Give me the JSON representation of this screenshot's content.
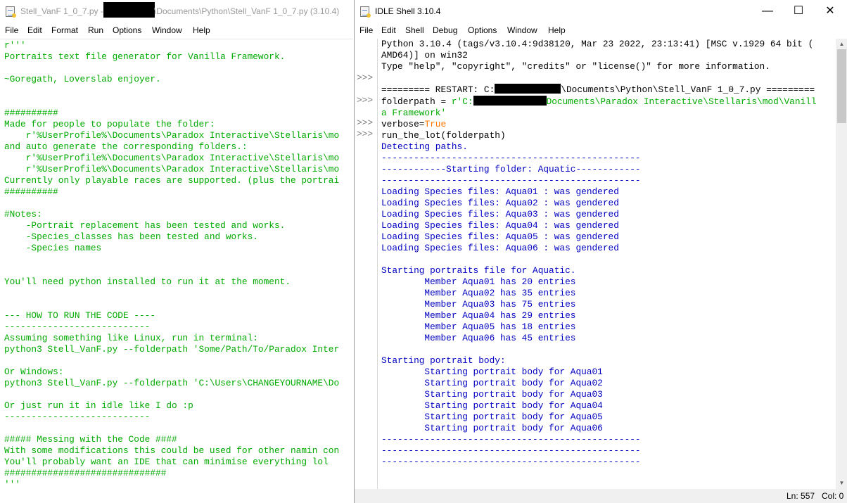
{
  "left_window": {
    "title_prefix": "Stell_VanF 1_0_7.py - C",
    "title_suffix": "\\Documents\\Python\\Stell_VanF 1_0_7.py (3.10.4)",
    "menu": [
      "File",
      "Edit",
      "Format",
      "Run",
      "Options",
      "Window",
      "Help"
    ],
    "code_lines": [
      "r'''",
      "Portraits text file generator for Vanilla Framework.",
      "",
      "~Goregath, Loverslab enjoyer.",
      "",
      "",
      "##########",
      "Made for people to populate the folder:",
      "    r'%UserProfile%\\Documents\\Paradox Interactive\\Stellaris\\mo",
      "and auto generate the corresponding folders.:",
      "    r'%UserProfile%\\Documents\\Paradox Interactive\\Stellaris\\mo",
      "    r'%UserProfile%\\Documents\\Paradox Interactive\\Stellaris\\mo",
      "Currently only playable races are supported. (plus the portrai",
      "##########",
      "",
      "#Notes:",
      "    -Portrait replacement has been tested and works.",
      "    -Species_classes has been tested and works.",
      "    -Species names",
      "",
      "",
      "You'll need python installed to run it at the moment.",
      "",
      "",
      "--- HOW TO RUN THE CODE ----",
      "---------------------------",
      "Assuming something like Linux, run in terminal:",
      "python3 Stell_VanF.py --folderpath 'Some/Path/To/Paradox Inter",
      "",
      "Or Windows:",
      "python3 Stell_VanF.py --folderpath 'C:\\Users\\CHANGEYOURNAME\\Do",
      "",
      "Or just run it in idle like I do :p",
      "---------------------------",
      "",
      "##### Messing with the Code ####",
      "With some modifications this could be used for other namin con",
      "You'll probably want an IDE that can minimise everything lol",
      "##############################",
      "'''"
    ]
  },
  "right_window": {
    "title": "IDLE Shell 3.10.4",
    "controls": {
      "minimize": "—",
      "maximize": "☐",
      "close": "✕"
    },
    "menu": [
      "File",
      "Edit",
      "Shell",
      "Debug",
      "Options",
      "Window",
      "Help"
    ],
    "gutter": [
      "",
      "",
      "",
      ">>>",
      "",
      ">>>",
      "",
      ">>>",
      ">>>"
    ],
    "prompt": ">>>",
    "header_lines": [
      "Python 3.10.4 (tags/v3.10.4:9d38120, Mar 23 2022, 23:13:41) [MSC v.1929 64 bit (",
      "AMD64)] on win32",
      "Type \"help\", \"copyright\", \"credits\" or \"license()\" for more information."
    ],
    "restart_prefix": "========= RESTART: C:",
    "restart_suffix": "\\Documents\\Python\\Stell_VanF 1_0_7.py =========",
    "cmd1_prefix": "folderpath = ",
    "cmd1_str_a": "r'C:",
    "cmd1_str_b": "Documents\\Paradox Interactive\\Stellaris\\mod\\Vanill",
    "cmd1_str_c": "a Framework'",
    "cmd2_prefix": "verbose=",
    "cmd2_value": "True",
    "cmd3": "run_the_lot(folderpath)",
    "output_lines": [
      "Detecting paths.",
      "------------------------------------------------",
      "------------Starting folder: Aquatic------------",
      "------------------------------------------------",
      "Loading Species files: Aqua01 : was gendered",
      "Loading Species files: Aqua02 : was gendered",
      "Loading Species files: Aqua03 : was gendered",
      "Loading Species files: Aqua04 : was gendered",
      "Loading Species files: Aqua05 : was gendered",
      "Loading Species files: Aqua06 : was gendered",
      "",
      "Starting portraits file for Aquatic.",
      "        Member Aqua01 has 20 entries",
      "        Member Aqua02 has 35 entries",
      "        Member Aqua03 has 75 entries",
      "        Member Aqua04 has 29 entries",
      "        Member Aqua05 has 18 entries",
      "        Member Aqua06 has 45 entries",
      "",
      "Starting portrait body:",
      "        Starting portrait body for Aqua01",
      "        Starting portrait body for Aqua02",
      "        Starting portrait body for Aqua03",
      "        Starting portrait body for Aqua04",
      "        Starting portrait body for Aqua05",
      "        Starting portrait body for Aqua06",
      "------------------------------------------------",
      "------------------------------------------------",
      "------------------------------------------------"
    ],
    "status": {
      "ln": "Ln: 557",
      "col": "Col: 0"
    }
  }
}
